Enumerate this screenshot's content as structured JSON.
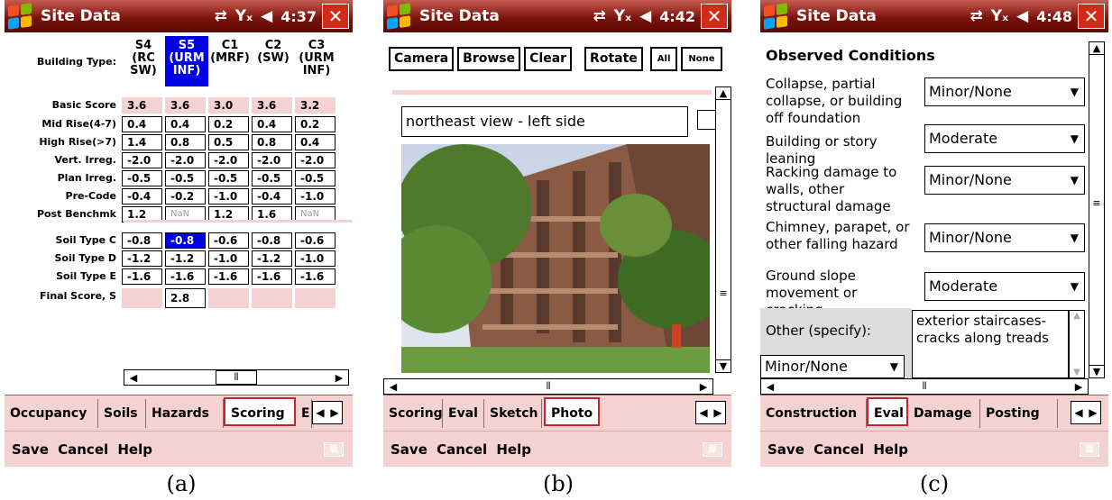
{
  "app": {
    "title": "Site Data",
    "sync_icon": "sync-icon",
    "signal_icon": "no-signal-icon",
    "volume_icon": "volume-icon",
    "close_label": "✕",
    "menu": {
      "save": "Save",
      "cancel": "Cancel",
      "help": "Help"
    }
  },
  "colors": {
    "titlebar": "#7c140c",
    "tab_bg": "#f4d2d2",
    "selection": "#0000e6",
    "accent": "#c1272d"
  },
  "panel_a": {
    "time": "4:37",
    "row_header": "Building Type:",
    "columns": [
      {
        "code": "S4",
        "sub1": "(RC",
        "sub2": "SW)"
      },
      {
        "code": "S5",
        "sub1": "(URM",
        "sub2": "INF)"
      },
      {
        "code": "C1",
        "sub1": "(MRF)",
        "sub2": ""
      },
      {
        "code": "C2",
        "sub1": "(SW)",
        "sub2": ""
      },
      {
        "code": "C3",
        "sub1": "(URM",
        "sub2": "INF)"
      }
    ],
    "rows": [
      {
        "label": "Basic Score",
        "values": [
          "3.6",
          "3.6",
          "3.0",
          "3.6",
          "3.2"
        ]
      },
      {
        "label": "Mid Rise(4-7)",
        "values": [
          "0.4",
          "0.4",
          "0.2",
          "0.4",
          "0.2"
        ]
      },
      {
        "label": "High Rise(>7)",
        "values": [
          "1.4",
          "0.8",
          "0.5",
          "0.8",
          "0.4"
        ]
      },
      {
        "label": "Vert. Irreg.",
        "values": [
          "-2.0",
          "-2.0",
          "-2.0",
          "-2.0",
          "-2.0"
        ]
      },
      {
        "label": "Plan Irreg.",
        "values": [
          "-0.5",
          "-0.5",
          "-0.5",
          "-0.5",
          "-0.5"
        ]
      },
      {
        "label": "Pre-Code",
        "values": [
          "-0.4",
          "-0.2",
          "-1.0",
          "-0.4",
          "-1.0"
        ]
      },
      {
        "label": "Post Benchmk",
        "values": [
          "1.2",
          "NaN",
          "1.2",
          "1.6",
          "NaN"
        ]
      },
      {
        "label": "Soil Type C",
        "values": [
          "-0.8",
          "-0.8",
          "-0.6",
          "-0.8",
          "-0.6"
        ]
      },
      {
        "label": "Soil Type D",
        "values": [
          "-1.2",
          "-1.2",
          "-1.0",
          "-1.2",
          "-1.0"
        ]
      },
      {
        "label": "Soil Type E",
        "values": [
          "-1.6",
          "-1.6",
          "-1.6",
          "-1.6",
          "-1.6"
        ]
      },
      {
        "label": "Final Score, S",
        "values": [
          "",
          "2.8",
          "",
          "",
          ""
        ]
      }
    ],
    "tabs": [
      "Occupancy",
      "Soils",
      "Hazards",
      "Scoring",
      "E"
    ],
    "active_tab": "Scoring",
    "caption": "(a)"
  },
  "panel_b": {
    "time": "4:42",
    "buttons": {
      "camera": "Camera",
      "browse": "Browse",
      "clear": "Clear",
      "rotate": "Rotate",
      "all": "All",
      "none": "None"
    },
    "caption_text": "northeast view - left side",
    "tabs": [
      "Scoring",
      "Eval",
      "Sketch",
      "Photo"
    ],
    "active_tab": "Photo",
    "caption": "(b)"
  },
  "panel_c": {
    "time": "4:48",
    "heading": "Observed Conditions",
    "conditions": [
      {
        "label": "Collapse, partial collapse, or building off foundation",
        "value": "Minor/None"
      },
      {
        "label": "Building or story leaning",
        "value": "Moderate"
      },
      {
        "label": "Racking damage to walls, other structural damage",
        "value": "Minor/None"
      },
      {
        "label": "Chimney, parapet, or other falling hazard",
        "value": "Minor/None"
      },
      {
        "label": "Ground slope movement or cracking",
        "value": "Moderate"
      }
    ],
    "other_label": "Other (specify):",
    "other_value": "Minor/None",
    "other_text": "exterior staircases- cracks along treads",
    "tabs": [
      "Construction",
      "Eval",
      "Damage",
      "Posting"
    ],
    "active_tab": "Eval",
    "caption": "(c)"
  }
}
